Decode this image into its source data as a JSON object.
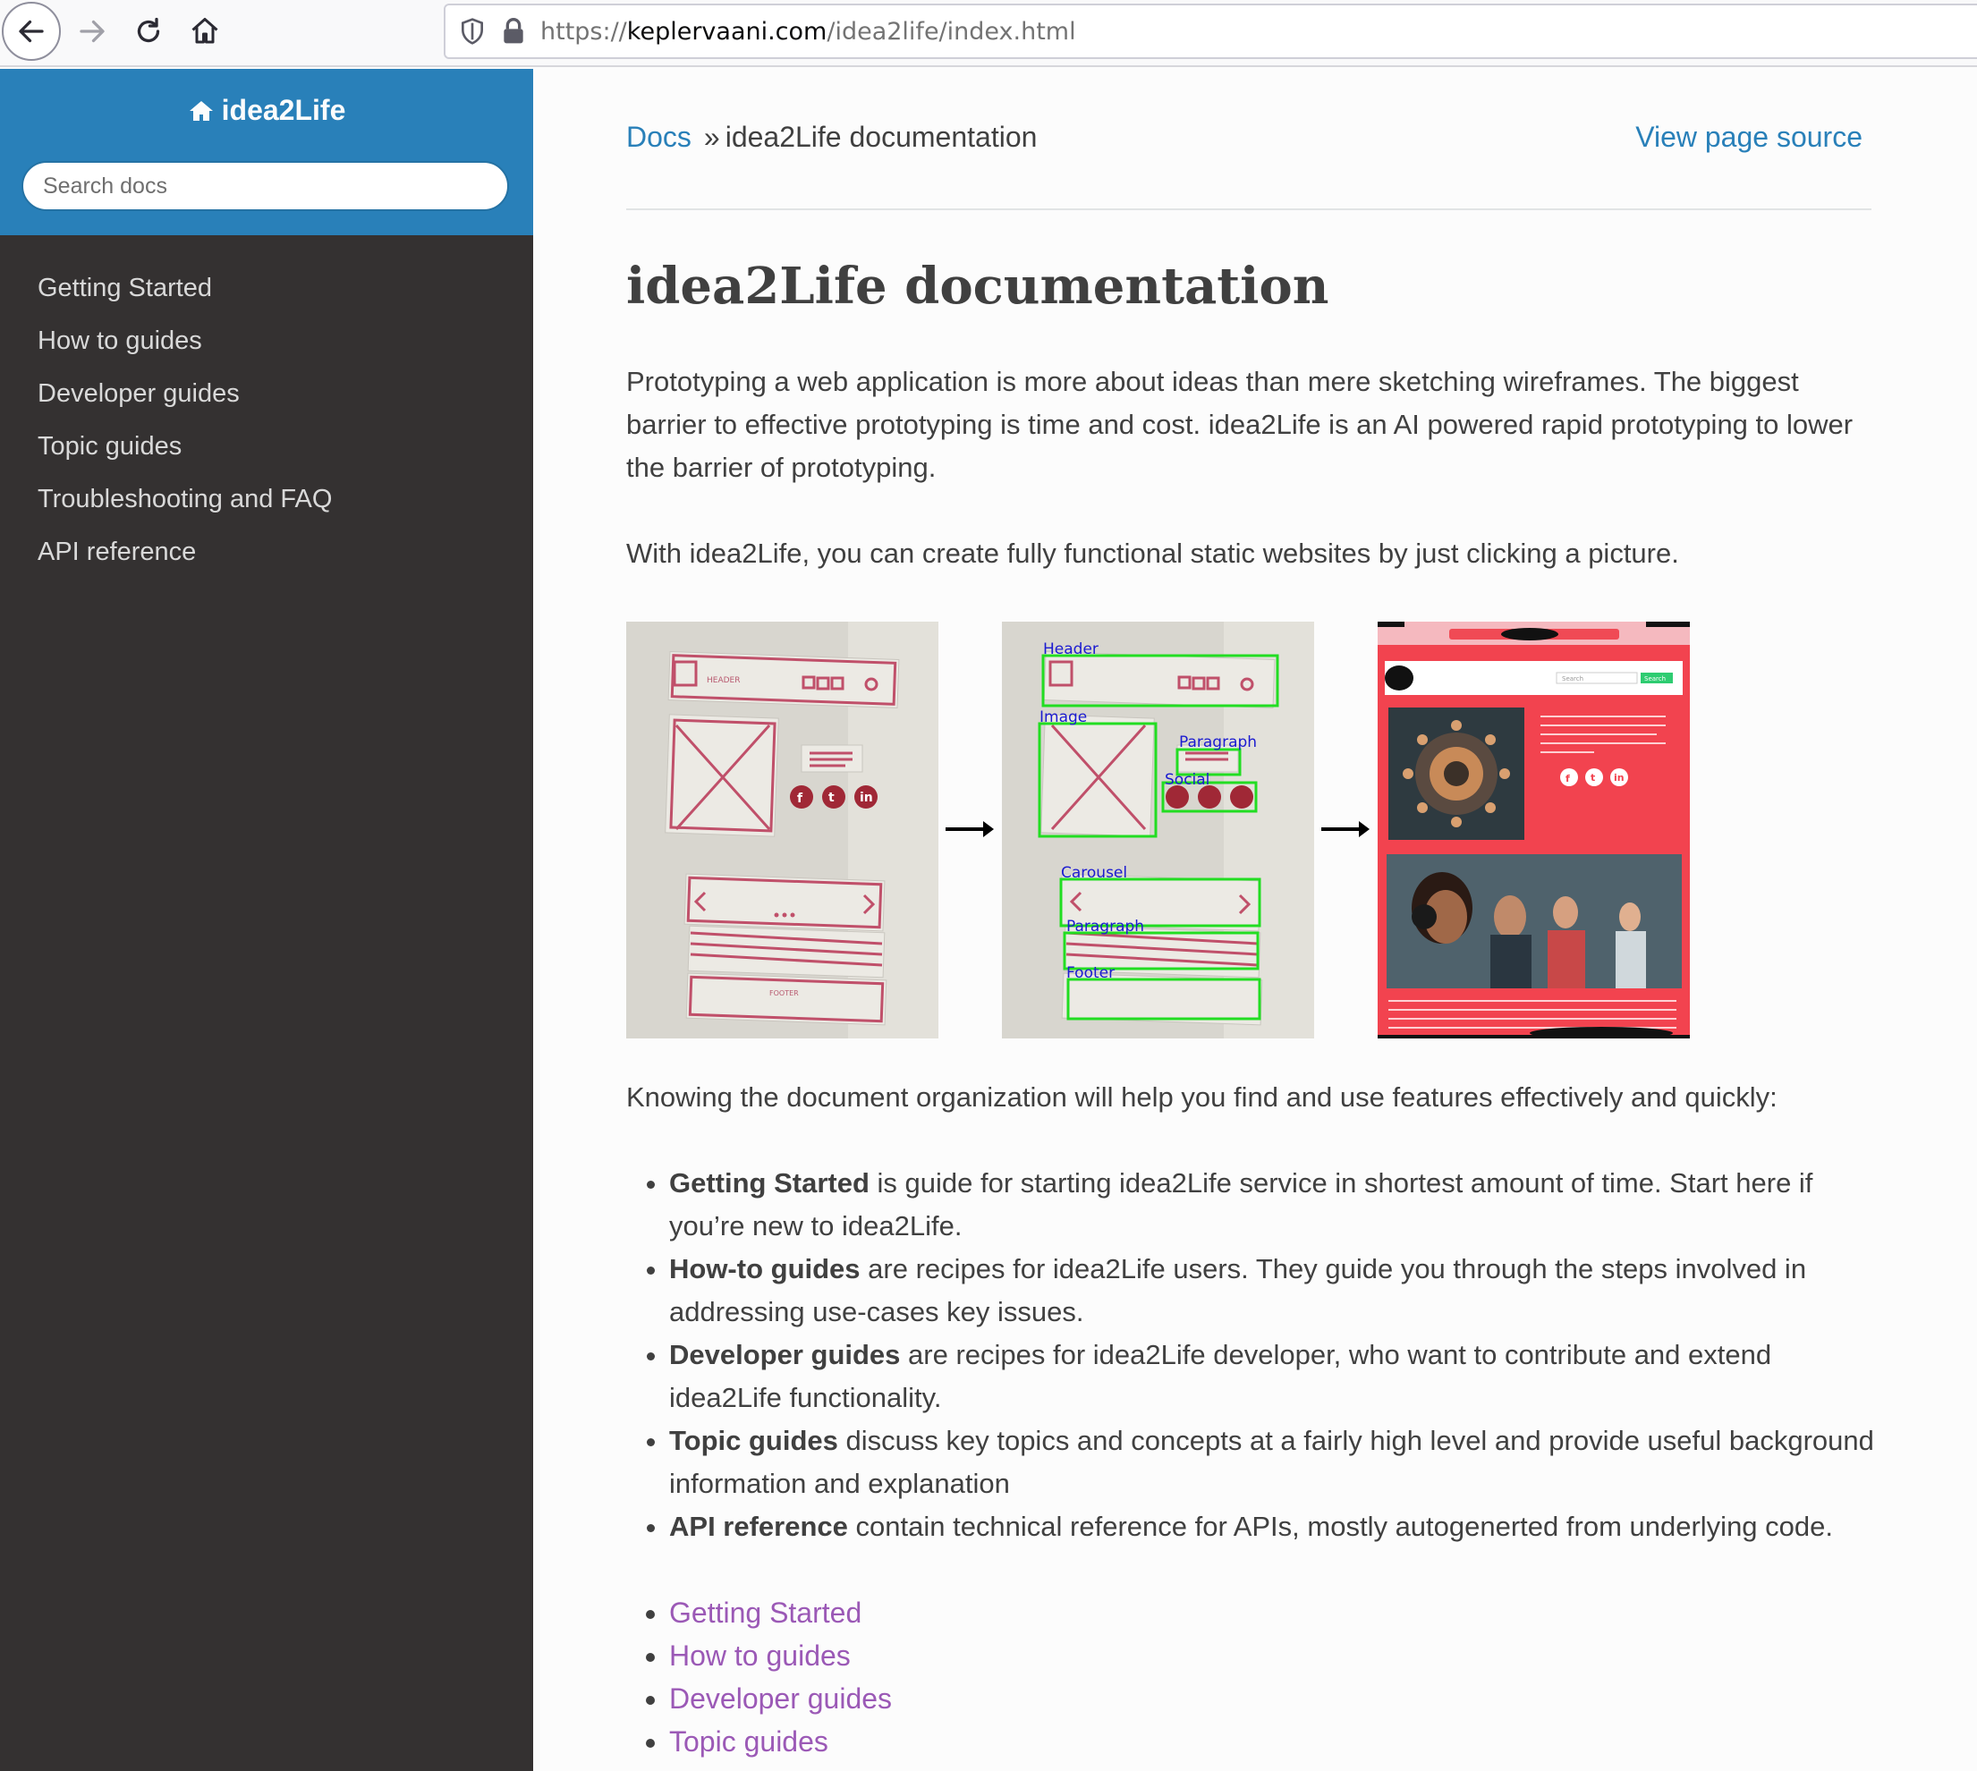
{
  "browser": {
    "url_prefix": "https://",
    "url_host": "keplervaani.com",
    "url_path": "/idea2life/index.html"
  },
  "sidebar": {
    "brand": "idea2Life",
    "search_placeholder": "Search docs",
    "items": [
      {
        "label": "Getting Started"
      },
      {
        "label": "How to guides"
      },
      {
        "label": "Developer guides"
      },
      {
        "label": "Topic guides"
      },
      {
        "label": "Troubleshooting and FAQ"
      },
      {
        "label": "API reference"
      }
    ]
  },
  "breadcrumb": {
    "docs": "Docs",
    "separator": "»",
    "current": "idea2Life documentation",
    "view_source": "View page source"
  },
  "main": {
    "title": "idea2Life documentation",
    "intro": "Prototyping a web application is more about ideas than mere sketching wireframes. The biggest barrier to effective prototyping is time and cost. idea2Life is an AI powered rapid prototyping to lower the barrier of prototyping.",
    "intro2": "With idea2Life, you can create fully functional static websites by just clicking a picture.",
    "figure_labels": [
      "Header",
      "Image",
      "Paragraph",
      "Social",
      "Carousel",
      "Paragraph",
      "Footer"
    ],
    "figure_search_label": "Search",
    "organization": "Knowing the document organization will help you find and use features effectively and quickly:",
    "features": [
      {
        "term": "Getting Started",
        "desc": " is guide for starting idea2Life service in shortest amount of time. Start here if you’re new to idea2Life."
      },
      {
        "term": "How-to guides",
        "desc": " are recipes for idea2Life users. They guide you through the steps involved in addressing use-cases key issues."
      },
      {
        "term": "Developer guides",
        "desc": " are recipes for idea2Life developer, who want to contribute and extend idea2Life functionality."
      },
      {
        "term": "Topic guides",
        "desc": " discuss key topics and concepts at a fairly high level and provide useful background information and explanation"
      },
      {
        "term": "API reference",
        "desc": " contain technical reference for APIs, mostly autogenerted from underlying code."
      }
    ],
    "toc_links": [
      {
        "label": "Getting Started"
      },
      {
        "label": "How to guides"
      },
      {
        "label": "Developer guides"
      },
      {
        "label": "Topic guides"
      }
    ]
  },
  "colors": {
    "sidebar_bg": "#343131",
    "brand_bg": "#2980b9",
    "link": "#2980b9",
    "visited_link": "#9b59b6"
  }
}
